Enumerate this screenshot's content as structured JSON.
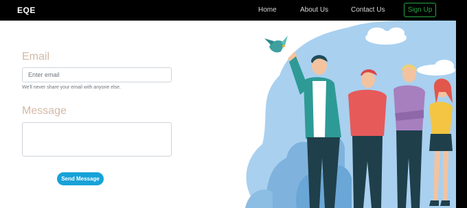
{
  "nav": {
    "brand": "EQE",
    "links": [
      "Home",
      "About Us",
      "Contact Us"
    ],
    "signup_label": "Sign Up"
  },
  "form": {
    "email_label": "Email",
    "email_placeholder": "Enter email",
    "email_help": "We'll never share your email with anyone else.",
    "message_label": "Message",
    "send_label": "Send Message"
  },
  "colors": {
    "navbar": "#000000",
    "signup_accent": "#28a745",
    "label": "#d4b9a6",
    "send_button": "#17a2d8",
    "illustration_sky": "#a9d0ef"
  },
  "illustration": {
    "icons": [
      "bird-icon",
      "cloud-icon",
      "person-icon"
    ]
  }
}
